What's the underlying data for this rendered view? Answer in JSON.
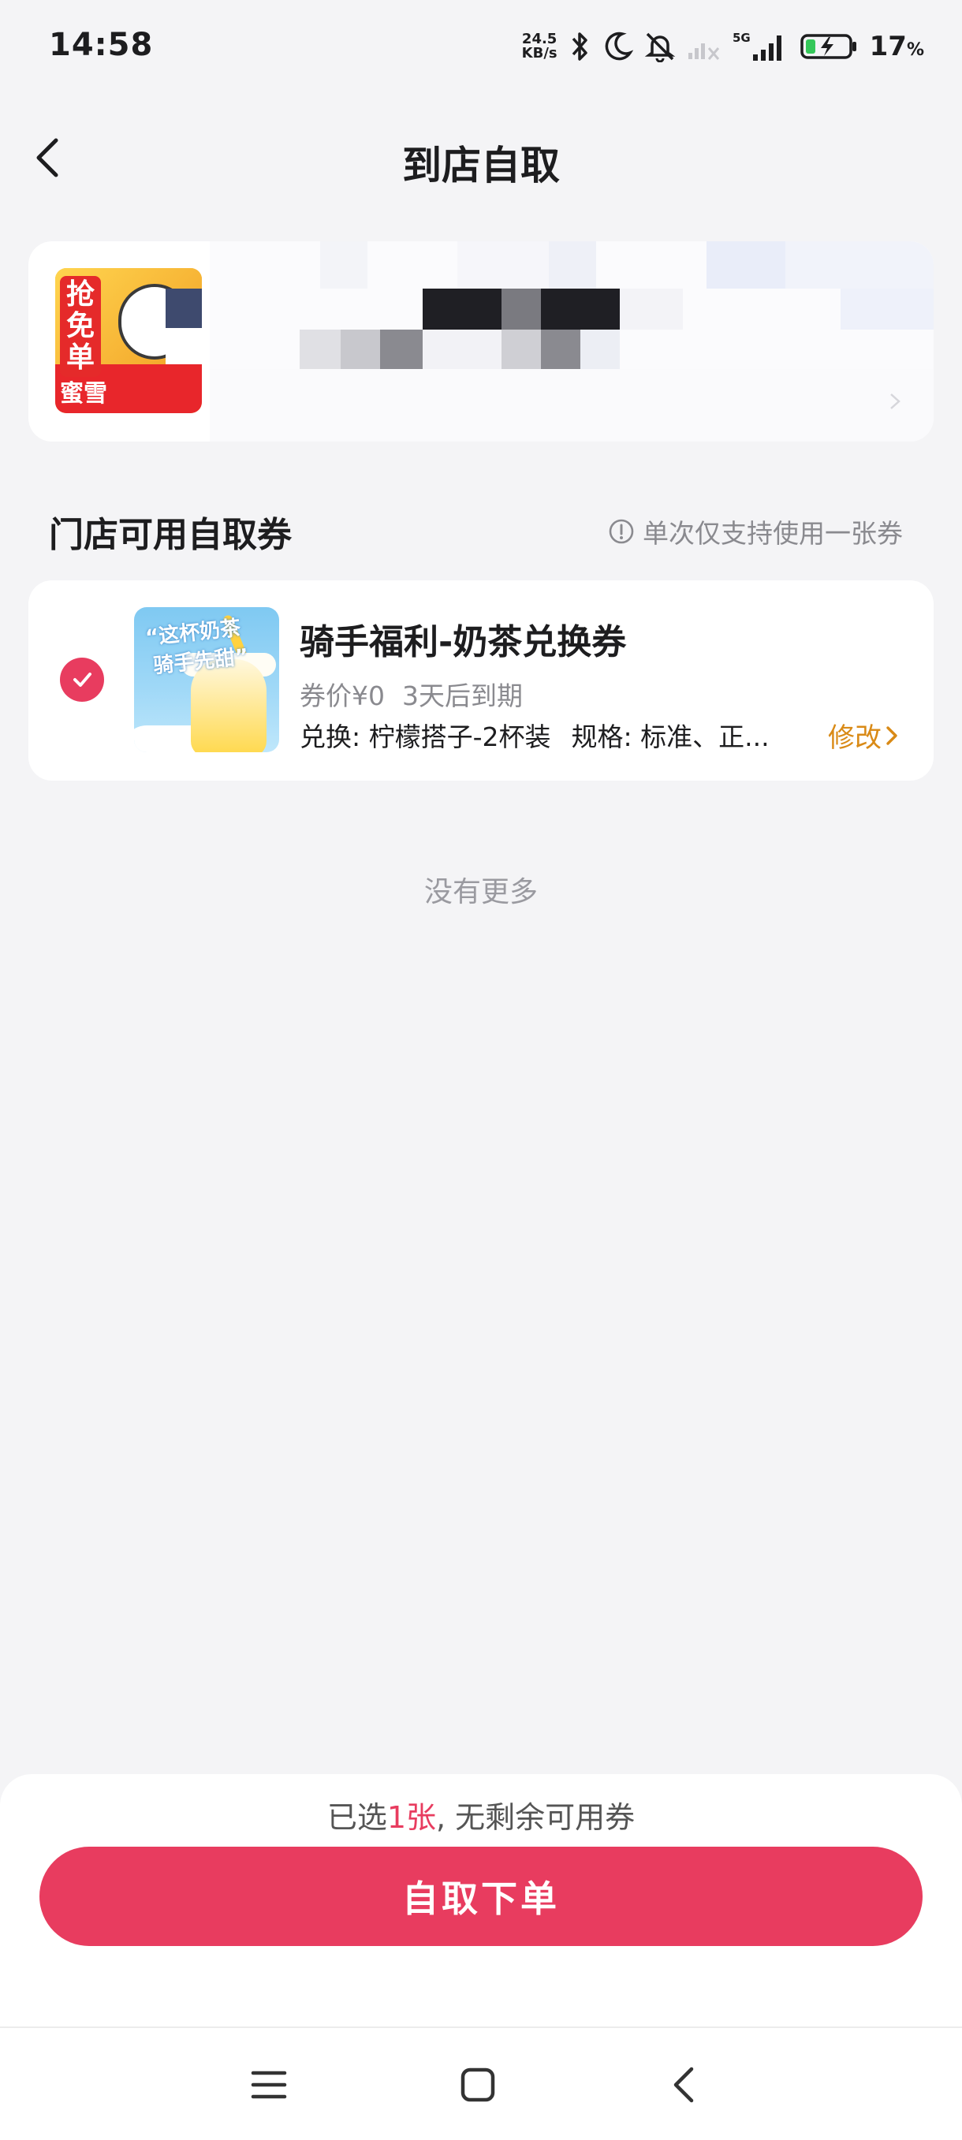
{
  "status_bar": {
    "time": "14:58",
    "net_speed_value": "24.5",
    "net_speed_unit": "KB/s",
    "network_type": "5G",
    "battery_percent": "17",
    "battery_suffix": "%"
  },
  "header": {
    "title": "到店自取"
  },
  "store": {
    "thumb_badge": "抢免单",
    "thumb_brand": "蜜雪"
  },
  "coupon_section": {
    "title": "门店可用自取券",
    "note": "单次仅支持使用一张券"
  },
  "coupon": {
    "image_text_line1": "“这杯奶茶",
    "image_text_line2": "骑手先甜”",
    "title": "骑手福利-奶茶兑换券",
    "price": "券价¥0",
    "expiry": "3天后到期",
    "exchange": "兑换: 柠檬搭子-2杯装",
    "spec": "规格: 标准、正...",
    "modify_label": "修改",
    "selected": true
  },
  "list_end_text": "没有更多",
  "footer": {
    "summary_prefix": "已选",
    "summary_count": "1张",
    "summary_suffix": ", 无剩余可用券",
    "order_button": "自取下单"
  },
  "colors": {
    "accent": "#e83c5f",
    "link": "#d98a16",
    "background": "#f4f4f6"
  }
}
